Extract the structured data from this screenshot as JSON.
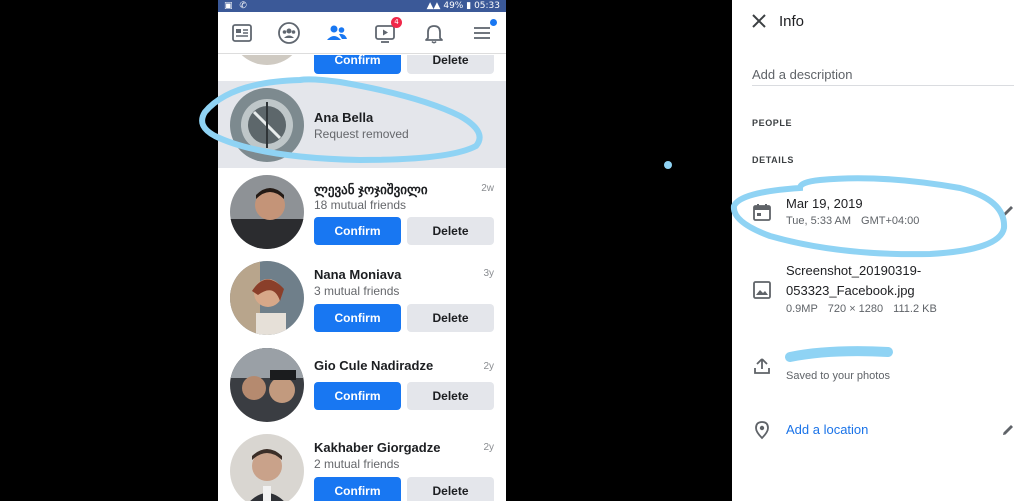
{
  "status_bar": {
    "battery": "49%",
    "time": "05:33"
  },
  "nav": {
    "icons": [
      "news-feed-icon",
      "groups-icon",
      "friends-icon",
      "watch-icon",
      "notifications-icon",
      "menu-icon"
    ],
    "watch_badge": "4"
  },
  "requests": [
    {
      "name": "",
      "subtitle": "",
      "age": "",
      "confirm_label": "Confirm",
      "delete_label": "Delete"
    },
    {
      "name": "Ana Bella",
      "subtitle": "Request removed",
      "age": ""
    },
    {
      "name": "ლევან ჯოჯიშვილი",
      "subtitle": "18 mutual friends",
      "age": "2w",
      "confirm_label": "Confirm",
      "delete_label": "Delete"
    },
    {
      "name": "Nana Moniava",
      "subtitle": "3 mutual friends",
      "age": "3y",
      "confirm_label": "Confirm",
      "delete_label": "Delete"
    },
    {
      "name": "Gio Cule Nadiradze",
      "subtitle": "",
      "age": "2y",
      "confirm_label": "Confirm",
      "delete_label": "Delete"
    },
    {
      "name": "Kakhaber Giorgadze",
      "subtitle": "2 mutual friends",
      "age": "2y",
      "confirm_label": "Confirm",
      "delete_label": "Delete"
    }
  ],
  "info": {
    "title": "Info",
    "description_placeholder": "Add a description",
    "people_heading": "PEOPLE",
    "details_heading": "DETAILS",
    "date": "Mar 19, 2019",
    "day_time": "Tue, 5:33 AM",
    "timezone": "GMT+04:00",
    "file_name_line1": "Screenshot_20190319-",
    "file_name_line2": "053323_Facebook.jpg",
    "megapixels": "0.9MP",
    "dimensions": "720 × 1280",
    "file_size": "111.2 KB",
    "backup_status": "Saved to your photos",
    "location_label": "Add a location"
  },
  "colors": {
    "facebook_blue": "#1877f2",
    "status_bar": "#3b5998",
    "annotation": "#8fd3f4",
    "link_blue": "#1a73e8"
  }
}
